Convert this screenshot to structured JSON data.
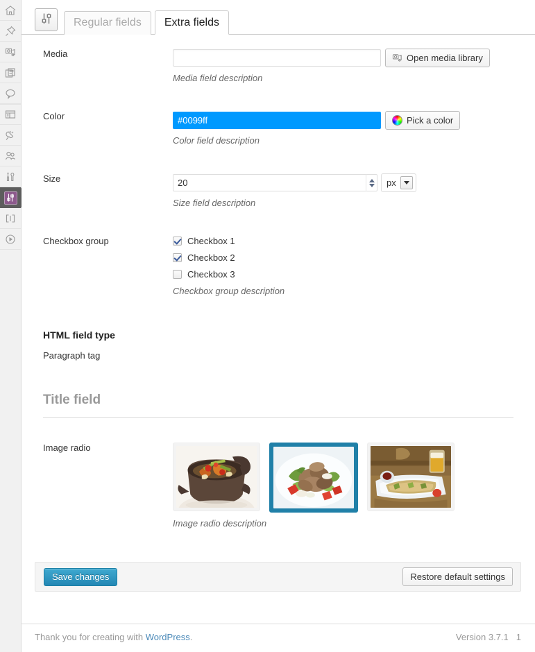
{
  "sidebar": {
    "items": [
      {
        "name": "dashboard",
        "icon": "home-icon",
        "active": false
      },
      {
        "name": "posts",
        "icon": "pin-icon",
        "active": false
      },
      {
        "name": "media",
        "icon": "camera-icon",
        "active": false
      },
      {
        "name": "pages",
        "icon": "pages-icon",
        "active": false
      },
      {
        "name": "comments",
        "icon": "comment-bubble-icon",
        "active": false
      },
      {
        "name": "appearance",
        "icon": "layout-icon",
        "active": false
      },
      {
        "name": "plugins",
        "icon": "plug-icon",
        "active": false
      },
      {
        "name": "users",
        "icon": "users-icon",
        "active": false
      },
      {
        "name": "tools",
        "icon": "tools-icon",
        "active": false
      },
      {
        "name": "settings",
        "icon": "sliders-icon",
        "active": true
      },
      {
        "name": "collapse",
        "icon": "brackets-icon",
        "active": false
      },
      {
        "name": "player",
        "icon": "play-circle-icon",
        "active": false
      }
    ]
  },
  "tabs": {
    "settings_icon": "sliders-icon",
    "items": [
      {
        "label": "Regular fields",
        "active": false
      },
      {
        "label": "Extra fields",
        "active": true
      }
    ]
  },
  "fields": {
    "media": {
      "label": "Media",
      "value": "",
      "placeholder": "",
      "button_label": "Open media library",
      "button_icon": "media-library-icon",
      "description": "Media field description"
    },
    "color": {
      "label": "Color",
      "value": "#0099ff",
      "swatch_hex": "#0099ff",
      "button_label": "Pick a color",
      "button_icon": "color-wheel-icon",
      "description": "Color field description"
    },
    "size": {
      "label": "Size",
      "value": "20",
      "unit": "px",
      "description": "Size field description"
    },
    "checkbox_group": {
      "label": "Checkbox group",
      "options": [
        {
          "label": "Checkbox 1",
          "checked": true
        },
        {
          "label": "Checkbox 2",
          "checked": true
        },
        {
          "label": "Checkbox 3",
          "checked": false
        }
      ],
      "description": "Checkbox group description"
    },
    "html_block": {
      "heading": "HTML field type",
      "paragraph": "Paragraph tag"
    },
    "title_field": {
      "heading": "Title field"
    },
    "image_radio": {
      "label": "Image radio",
      "options": [
        {
          "alt": "Stir-fried vegetables and meat in a dark clay pot",
          "selected": false
        },
        {
          "alt": "Sliced meat salad with tomato and greens on a white plate",
          "selected": true
        },
        {
          "alt": "Baked dish on a white plate with sauce and a glass of beer",
          "selected": false
        }
      ],
      "description": "Image radio description"
    }
  },
  "submit_bar": {
    "save_label": "Save changes",
    "restore_label": "Restore default settings"
  },
  "footer": {
    "thanks_prefix": "Thank you for creating with ",
    "wordpress_link": "WordPress",
    "thanks_suffix": ".",
    "version": "Version 3.7.1",
    "edge_marker": "1"
  },
  "colors": {
    "accent_blue": "#0099ff",
    "primary_button": "#2387b4",
    "selected_border": "#2080a8",
    "active_menu_bg": "#5d5d5d",
    "active_menu_icon_bg": "#8d5a8d"
  }
}
